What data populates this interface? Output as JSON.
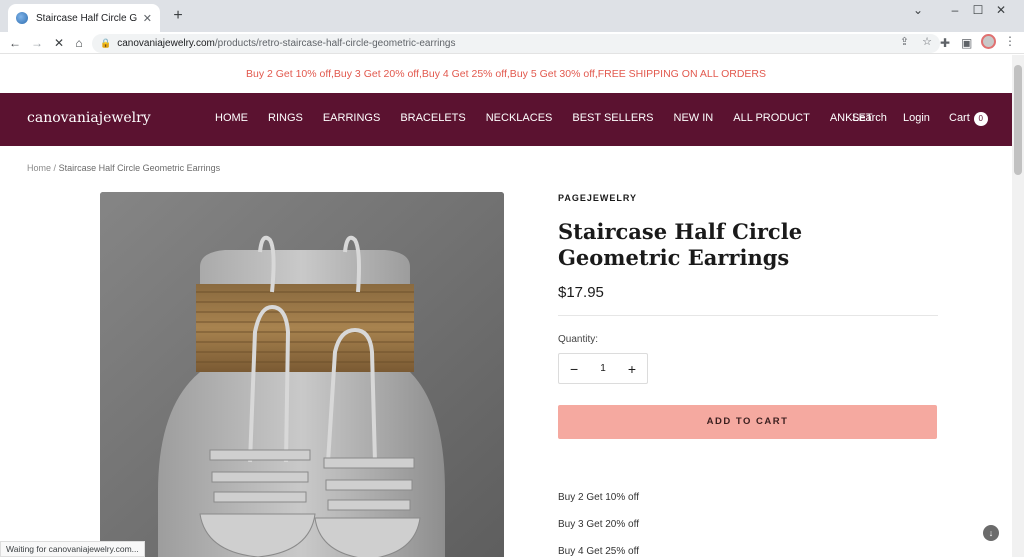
{
  "browser": {
    "tab_title": "Staircase Half Circle Geometric E",
    "url_host": "canovaniajewelry.com",
    "url_path": "/products/retro-staircase-half-circle-geometric-earrings",
    "status": "Waiting for canovaniajewelry.com..."
  },
  "promo": "Buy 2 Get 10% off,Buy 3 Get 20% off,Buy 4 Get 25% off,Buy 5 Get 30% off,FREE SHIPPING ON ALL ORDERS",
  "header": {
    "logo": "canovaniajewelry",
    "nav": [
      "HOME",
      "RINGS",
      "EARRINGS",
      "BRACELETS",
      "NECKLACES",
      "BEST SELLERS",
      "NEW IN",
      "ALL PRODUCT",
      "ANKLET"
    ],
    "search": "Search",
    "login": "Login",
    "cart": "Cart",
    "cart_count": "0"
  },
  "breadcrumb": {
    "home": "Home",
    "sep": "/",
    "current": "Staircase Half Circle Geometric Earrings"
  },
  "product": {
    "vendor": "PAGEJEWELRY",
    "title": "Staircase Half Circle Geometric Earrings",
    "price": "$17.95",
    "quantity_label": "Quantity:",
    "quantity": "1",
    "add_to_cart": "ADD TO CART",
    "offers": [
      "Buy 2 Get 10% off",
      "Buy 3 Get 20% off",
      "Buy 4 Get 25% off"
    ]
  },
  "colors": {
    "header_bg": "#5b1230",
    "promo_text": "#e2594e",
    "add_to_cart_bg": "#f5a9a0"
  }
}
